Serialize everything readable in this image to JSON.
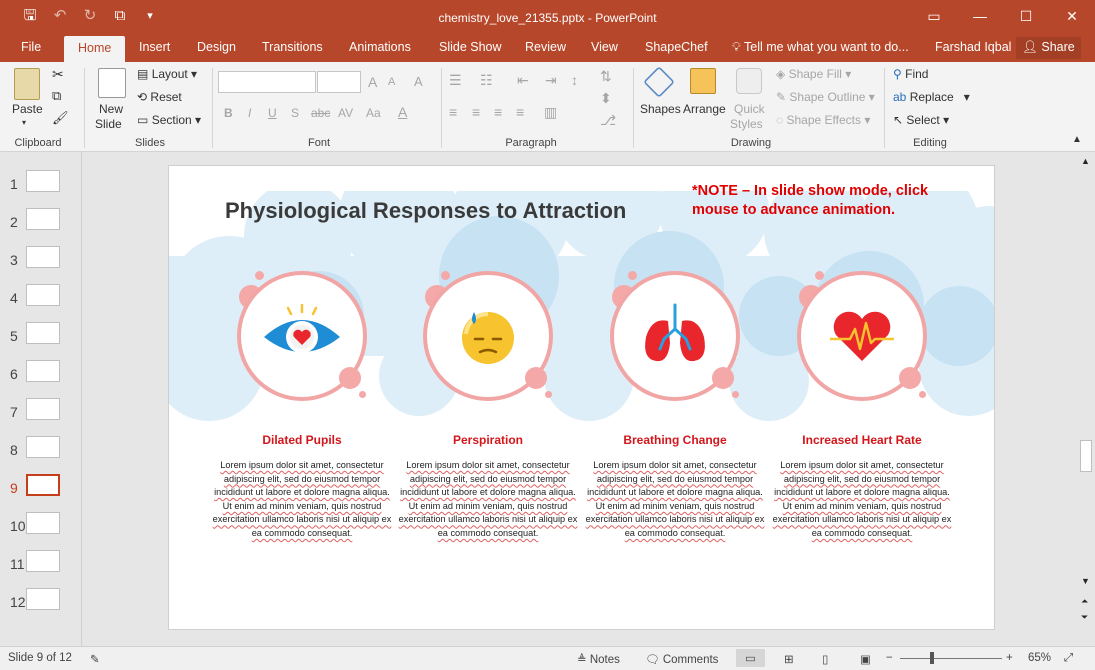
{
  "window": {
    "doc_title": "chemistry_love_21355.pptx - PowerPoint",
    "user": "Farshad Iqbal",
    "share_label": "Share"
  },
  "qat": {
    "save": "🖫",
    "undo": "↶",
    "redo": "↻",
    "present": "⧉",
    "more": "▾"
  },
  "tabs": [
    "File",
    "Home",
    "Insert",
    "Design",
    "Transitions",
    "Animations",
    "Slide Show",
    "Review",
    "View",
    "ShapeChef"
  ],
  "tell_me": "Tell me what you want to do...",
  "ribbon": {
    "clipboard": {
      "paste": "Paste",
      "label": "Clipboard"
    },
    "slides": {
      "new_slide": "New",
      "new_slide2": "Slide",
      "layout": "Layout",
      "reset": "Reset",
      "section": "Section",
      "label": "Slides"
    },
    "font": {
      "label": "Font",
      "bold": "B",
      "italic": "I",
      "underline": "U",
      "shadow": "S",
      "strike": "abc",
      "spacing": "AV",
      "case": "Aa",
      "grow": "A",
      "shrink": "A",
      "clear": "A"
    },
    "paragraph": {
      "label": "Paragraph"
    },
    "drawing": {
      "shapes": "Shapes",
      "arrange": "Arrange",
      "quick": "Quick",
      "styles": "Styles",
      "fill": "Shape Fill",
      "outline": "Shape Outline",
      "effects": "Shape Effects",
      "label": "Drawing"
    },
    "editing": {
      "find": "Find",
      "replace": "Replace",
      "select": "Select",
      "label": "Editing"
    }
  },
  "thumbnails": [
    "1",
    "2",
    "3",
    "4",
    "5",
    "6",
    "7",
    "8",
    "9",
    "10",
    "11",
    "12"
  ],
  "selected_slide": "9",
  "slide": {
    "title": "Physiological Responses to Attraction",
    "note": "*NOTE – In slide show mode, click mouse to advance animation.",
    "items": [
      {
        "title": "Dilated Pupils",
        "icon": "eye-heart-icon",
        "body": "Lorem ipsum dolor sit amet, consectetur adipiscing elit, sed do eiusmod tempor incididunt ut labore et dolore magna aliqua. Ut enim ad minim veniam, quis nostrud exercitation ullamco laboris nisi ut aliquip ex ea commodo consequat."
      },
      {
        "title": "Perspiration",
        "icon": "sweating-face-icon",
        "body": "Lorem ipsum dolor sit amet, consectetur adipiscing elit, sed do eiusmod tempor incididunt ut labore et dolore magna aliqua. Ut enim ad minim veniam, quis nostrud exercitation ullamco laboris nisi ut aliquip ex ea commodo consequat."
      },
      {
        "title": "Breathing Change",
        "icon": "lungs-icon",
        "body": "Lorem ipsum dolor sit amet, consectetur adipiscing elit, sed do eiusmod tempor incididunt ut labore et dolore magna aliqua. Ut enim ad minim veniam, quis nostrud exercitation ullamco laboris nisi ut aliquip ex ea commodo consequat."
      },
      {
        "title": "Increased Heart Rate",
        "icon": "heartbeat-icon",
        "body": "Lorem ipsum dolor sit amet, consectetur adipiscing elit, sed do eiusmod tempor incididunt ut labore et dolore magna aliqua. Ut enim ad minim veniam, quis nostrud exercitation ullamco laboris nisi ut aliquip ex ea commodo consequat."
      }
    ]
  },
  "status": {
    "slide_info": "Slide 9 of 12",
    "notes": "Notes",
    "comments": "Comments",
    "zoom": "65%",
    "minus": "−",
    "plus": "+"
  },
  "colors": {
    "accent": "#b7472a",
    "title_red": "#d3161b",
    "circle": "#f2a5a5",
    "cloud": "#dcedf7"
  }
}
